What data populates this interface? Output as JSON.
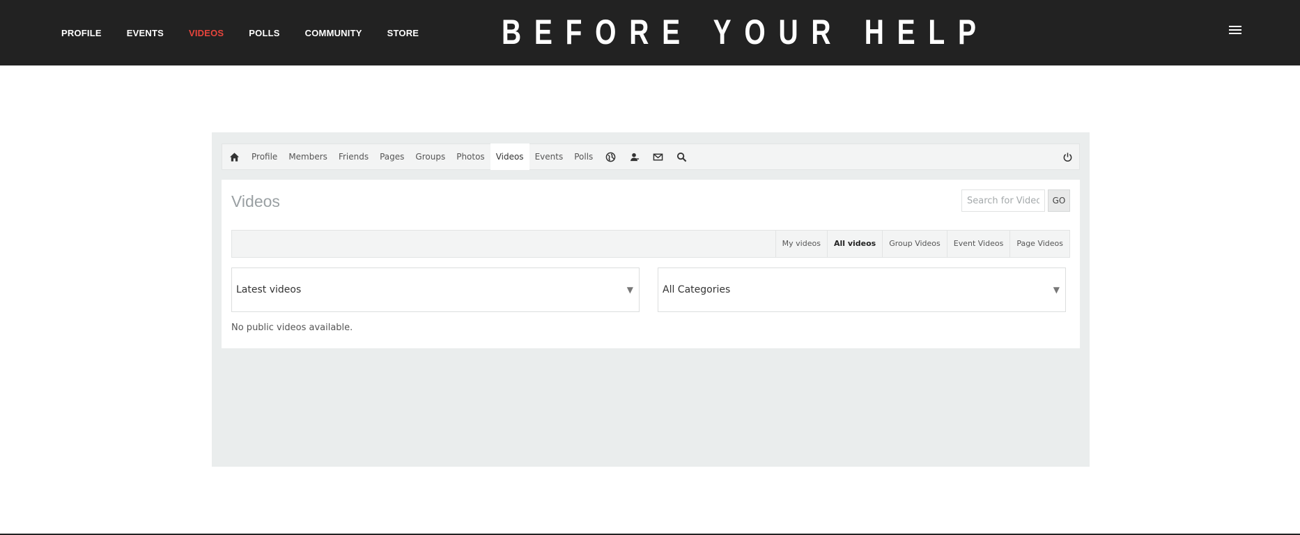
{
  "header": {
    "nav": [
      "PROFILE",
      "EVENTS",
      "VIDEOS",
      "POLLS",
      "COMMUNITY",
      "STORE"
    ],
    "active_nav": "VIDEOS",
    "logo": "BEFORE YOUR HELP",
    "menu_icon": "hamburger-icon",
    "accent_color": "#e8453c"
  },
  "toolbar": {
    "items": [
      "Profile",
      "Members",
      "Friends",
      "Pages",
      "Groups",
      "Photos",
      "Videos",
      "Events",
      "Polls"
    ],
    "active": "Videos",
    "icons": [
      "home-icon",
      "globe-icon",
      "user-icon",
      "mail-icon",
      "search-icon",
      "power-icon"
    ]
  },
  "main": {
    "title": "Videos",
    "search_placeholder": "Search for Videos",
    "go_label": "GO",
    "filter_tabs": [
      "My videos",
      "All videos",
      "Group Videos",
      "Event Videos",
      "Page Videos"
    ],
    "active_filter": "All videos",
    "sort_select": "Latest videos",
    "category_select": "All Categories",
    "empty_message": "No public videos available."
  }
}
